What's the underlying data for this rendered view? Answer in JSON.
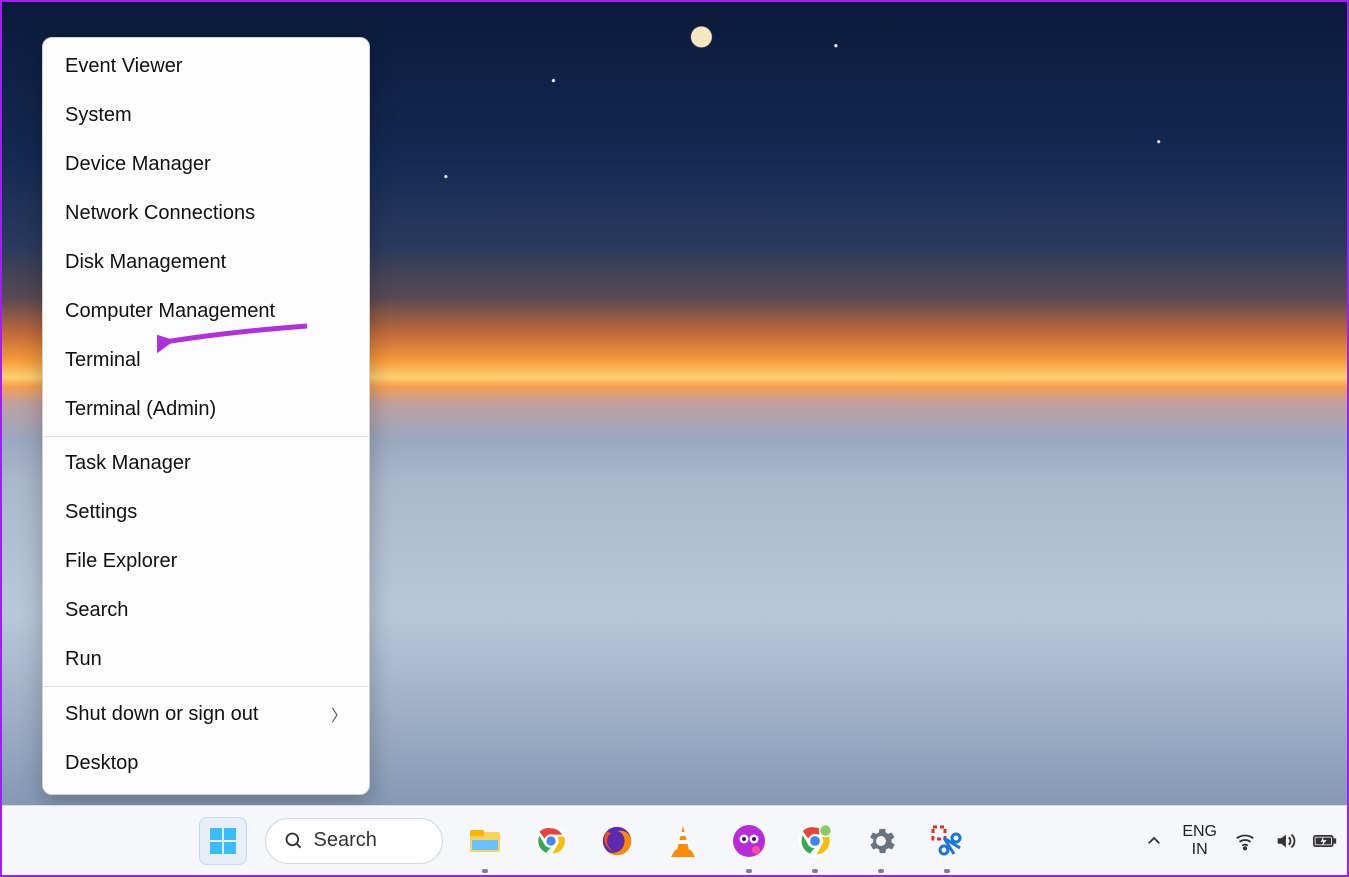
{
  "context_menu": {
    "groups": [
      [
        "Event Viewer",
        "System",
        "Device Manager",
        "Network Connections",
        "Disk Management",
        "Computer Management",
        "Terminal",
        "Terminal (Admin)"
      ],
      [
        "Task Manager",
        "Settings",
        "File Explorer",
        "Search",
        "Run"
      ],
      [
        {
          "label": "Shut down or sign out",
          "submenu": true
        },
        "Desktop"
      ]
    ]
  },
  "annotation": {
    "points_to": "Terminal",
    "color": "#b030e0"
  },
  "taskbar": {
    "search_label": "Search",
    "icons": [
      {
        "name": "start-button",
        "label": "Start"
      },
      {
        "name": "search-pill",
        "label": "Search"
      },
      {
        "name": "file-explorer-icon",
        "label": "File Explorer",
        "running": true
      },
      {
        "name": "chrome-icon",
        "label": "Google Chrome"
      },
      {
        "name": "firefox-icon",
        "label": "Firefox"
      },
      {
        "name": "vlc-icon",
        "label": "VLC media player"
      },
      {
        "name": "app-purple-icon",
        "label": "App",
        "running": true
      },
      {
        "name": "chrome-profile-icon",
        "label": "Chrome (profile)",
        "running": true
      },
      {
        "name": "settings-icon",
        "label": "Settings",
        "running": true
      },
      {
        "name": "snipping-tool-icon",
        "label": "Snipping Tool",
        "running": true
      }
    ],
    "tray": {
      "overflow": "Show hidden icons",
      "language_top": "ENG",
      "language_bottom": "IN",
      "wifi": "Wi-Fi",
      "volume": "Volume",
      "battery": "Battery charging"
    }
  }
}
